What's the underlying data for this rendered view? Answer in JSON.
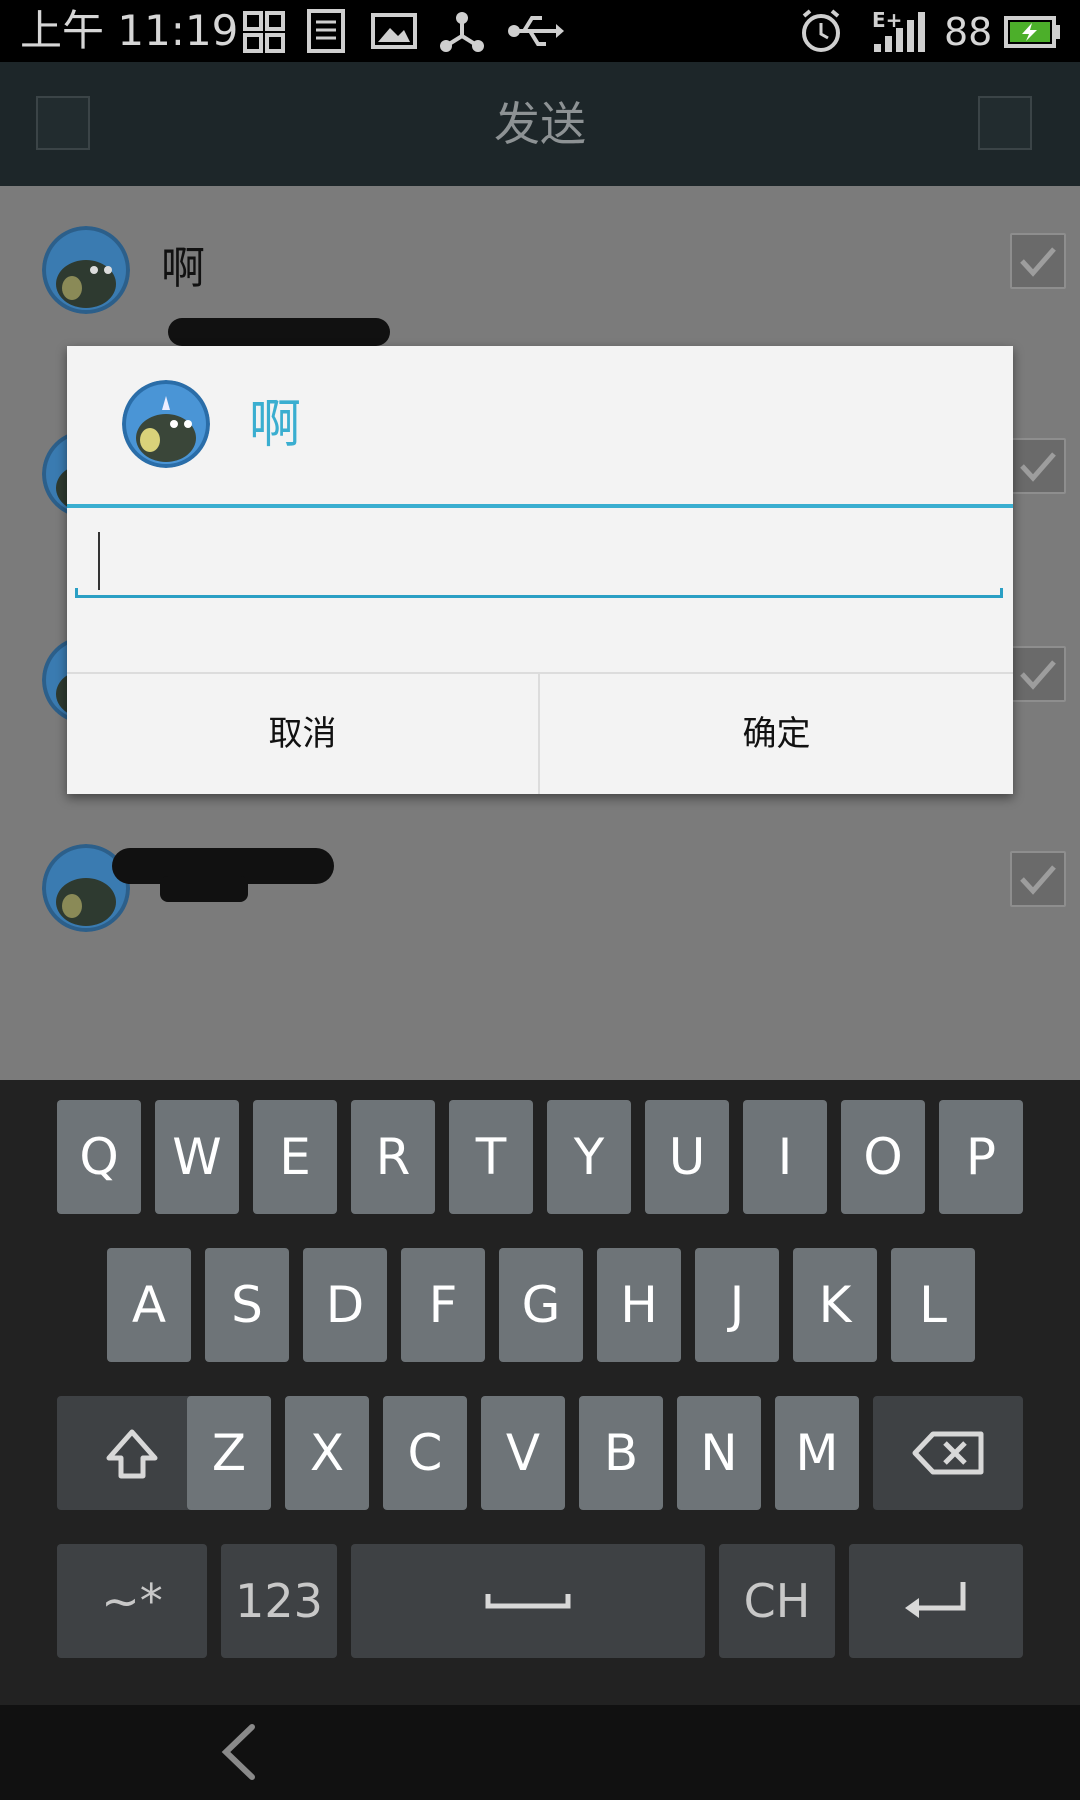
{
  "status_bar": {
    "time": "上午 11:19",
    "network": "E+",
    "battery": "88",
    "icons": [
      "grid-icon",
      "document-icon",
      "image-icon",
      "share-icon",
      "usb-icon",
      "alarm-icon",
      "signal-icon",
      "battery-charging-icon"
    ]
  },
  "app_bar": {
    "title": "发送"
  },
  "contacts": [
    {
      "name": "啊",
      "checked": true
    },
    {
      "name": "",
      "checked": true
    },
    {
      "name": "",
      "checked": true
    },
    {
      "name": "",
      "checked": true
    }
  ],
  "dialog": {
    "title": "啊",
    "input_value": "",
    "cancel_label": "取消",
    "ok_label": "确定"
  },
  "keyboard": {
    "row1": [
      "Q",
      "W",
      "E",
      "R",
      "T",
      "Y",
      "U",
      "I",
      "O",
      "P"
    ],
    "row2": [
      "A",
      "S",
      "D",
      "F",
      "G",
      "H",
      "J",
      "K",
      "L"
    ],
    "row3": [
      "Z",
      "X",
      "C",
      "V",
      "B",
      "N",
      "M"
    ],
    "symbols_label": "~*",
    "numbers_label": "123",
    "lang_label": "CH"
  },
  "colors": {
    "accent": "#3aaed0"
  }
}
